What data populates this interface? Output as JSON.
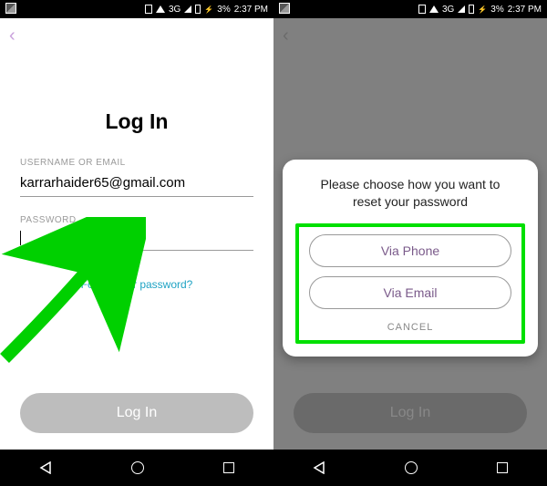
{
  "status": {
    "network": "3G",
    "battery": "3%",
    "time": "2:37 PM"
  },
  "screen1": {
    "title": "Log In",
    "username_label": "USERNAME OR EMAIL",
    "username_value": "karrarhaider65@gmail.com",
    "password_label": "PASSWORD",
    "password_value": "",
    "forgot": "Forgot your password?",
    "login_button": "Log In"
  },
  "screen2": {
    "login_button": "Log In",
    "modal_title": "Please choose how you want to reset your password",
    "via_phone": "Via Phone",
    "via_email": "Via Email",
    "cancel": "CANCEL"
  }
}
